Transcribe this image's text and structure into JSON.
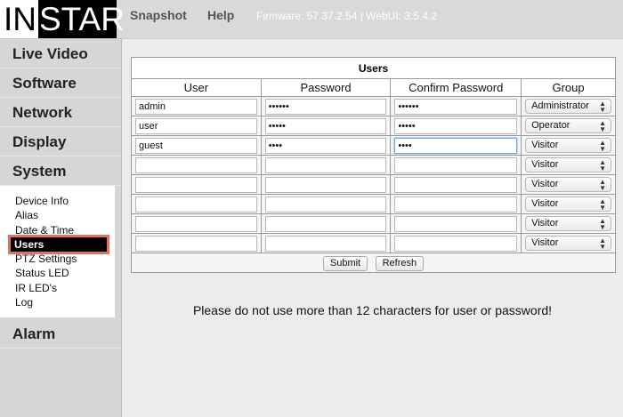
{
  "header": {
    "logo_in": "IN",
    "logo_star": "STAR",
    "snapshot_label": "Snapshot",
    "help_label": "Help",
    "firmware_text": "Firmware: 57.37.2.54 | WebUI: 3.5.4.2"
  },
  "sidebar": {
    "menu": [
      "Live Video",
      "Software",
      "Network",
      "Display",
      "System"
    ],
    "submenu": [
      "Device Info",
      "Alias",
      "Date & Time",
      "Users",
      "PTZ Settings",
      "Status LED",
      "IR LED's",
      "Log"
    ],
    "active_submenu": "Users",
    "bottom": "Alarm"
  },
  "users": {
    "title": "Users",
    "columns": [
      "User",
      "Password",
      "Confirm Password",
      "Group"
    ],
    "rows": [
      {
        "user": "admin",
        "password": "••••••",
        "confirm": "••••••",
        "group": "Administrator"
      },
      {
        "user": "user",
        "password": "•••••",
        "confirm": "•••••",
        "group": "Operator"
      },
      {
        "user": "guest",
        "password": "••••",
        "confirm": "••••",
        "group": "Visitor"
      },
      {
        "user": "",
        "password": "",
        "confirm": "",
        "group": "Visitor"
      },
      {
        "user": "",
        "password": "",
        "confirm": "",
        "group": "Visitor"
      },
      {
        "user": "",
        "password": "",
        "confirm": "",
        "group": "Visitor"
      },
      {
        "user": "",
        "password": "",
        "confirm": "",
        "group": "Visitor"
      },
      {
        "user": "",
        "password": "",
        "confirm": "",
        "group": "Visitor"
      }
    ],
    "submit_label": "Submit",
    "refresh_label": "Refresh"
  },
  "notice": "Please do not use more than 12 characters for user or password!"
}
